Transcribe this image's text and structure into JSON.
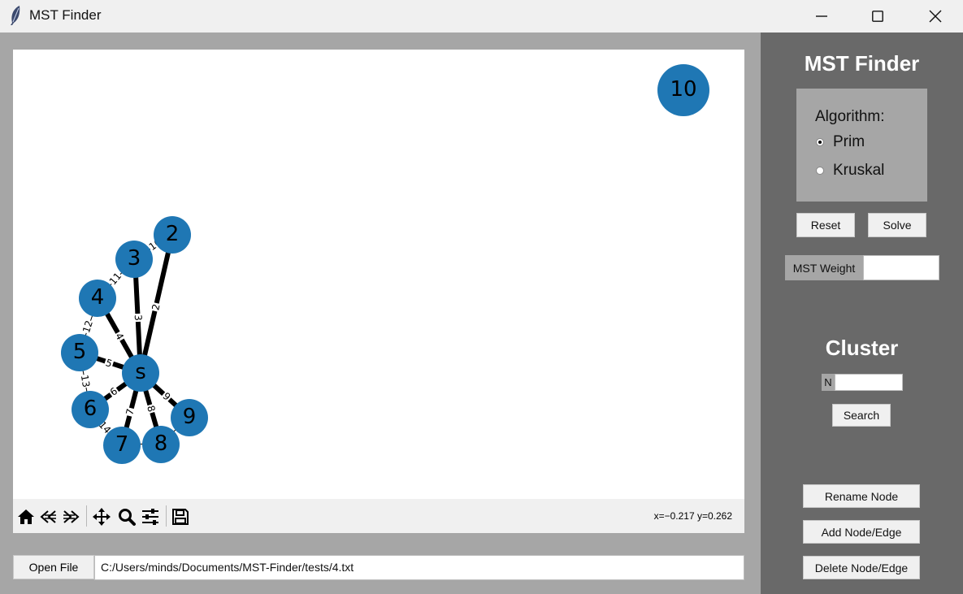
{
  "window": {
    "title": "MST Finder"
  },
  "graph": {
    "nodes": [
      "10",
      "2",
      "3",
      "4",
      "5",
      "s",
      "6",
      "9",
      "7",
      "8"
    ],
    "edge_labels": [
      "10",
      "11",
      "2",
      "3",
      "12",
      "4",
      "5",
      "13",
      "6",
      "9",
      "7",
      "8",
      "14"
    ],
    "node_color": "#1f77b4"
  },
  "toolbar": {
    "icons": [
      "home-icon",
      "back-icon",
      "forward-icon",
      "pan-icon",
      "zoom-icon",
      "configure-subplots-icon",
      "save-icon"
    ],
    "coords": "x=−0.217 y=0.262"
  },
  "file": {
    "open_label": "Open File",
    "path": "C:/Users/minds/Documents/MST-Finder/tests/4.txt"
  },
  "panel": {
    "title": "MST Finder",
    "algorithm_label": "Algorithm:",
    "options": [
      "Prim",
      "Kruskal"
    ],
    "selected": "Prim",
    "reset_label": "Reset",
    "solve_label": "Solve",
    "mst_weight_label": "MST Weight",
    "mst_weight_value": "",
    "cluster_title": "Cluster",
    "cluster_n_label": "N",
    "cluster_n_value": "",
    "search_label": "Search",
    "rename_label": "Rename Node",
    "add_label": "Add Node/Edge",
    "delete_label": "Delete Node/Edge"
  }
}
